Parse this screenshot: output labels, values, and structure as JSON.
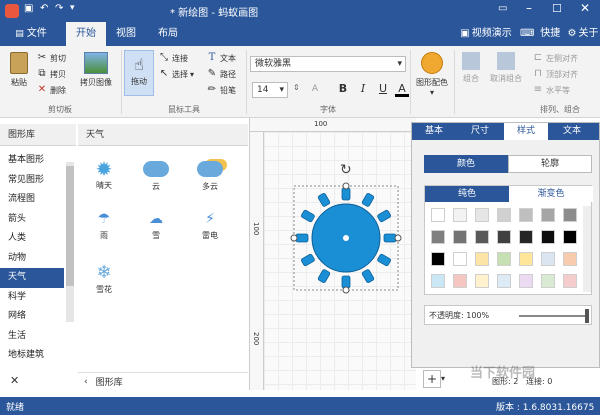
{
  "title": "* 新绘图 - 蚂蚁画图",
  "menu": {
    "file": "文件",
    "tabs": [
      "开始",
      "视图",
      "布局"
    ],
    "video": "视频演示",
    "shortcut": "快捷键",
    "about": "关于"
  },
  "ribbon": {
    "clipboard": {
      "paste": "粘贴",
      "cut": "剪切",
      "copy": "拷贝",
      "delete": "删除",
      "copy_image": "拷贝图像",
      "label": "剪切板"
    },
    "tools": {
      "drag": "拖动",
      "connect": "连接",
      "select": "选择",
      "text": "文本",
      "path": "路径",
      "pencil": "铅笔",
      "label": "鼠标工具"
    },
    "font": {
      "family": "微软雅黑",
      "size": "14",
      "bold": "B",
      "italic": "I",
      "underline": "U",
      "color": "A",
      "label": "字体"
    },
    "shape_color": "图形配色",
    "arrange": {
      "combine": "组合",
      "uncombine": "取消组合",
      "align_left": "左侧对齐",
      "align_top": "顶部对齐",
      "align_h": "水平等",
      "label": "排列、组合"
    }
  },
  "library": {
    "header": "图形库",
    "categories": [
      "基本图形",
      "常见图形",
      "流程图",
      "箭头",
      "人类",
      "动物",
      "天气",
      "科学",
      "网络",
      "生活",
      "地标建筑"
    ],
    "active_index": 6,
    "panel_title": "天气",
    "shapes": [
      "晴天",
      "云",
      "多云",
      "雨",
      "雪",
      "雷电",
      "雪花"
    ],
    "footer": "图形库"
  },
  "canvas": {
    "ruler_labels": [
      "100",
      "200"
    ],
    "vruler_labels": [
      "100",
      "200"
    ]
  },
  "right_panel": {
    "tabs": [
      "基本",
      "尺寸",
      "样式",
      "文本"
    ],
    "active_tab": 2,
    "sub_tabs": [
      "颜色",
      "轮廓"
    ],
    "color_tabs": [
      "纯色",
      "渐变色"
    ],
    "opacity_label": "不透明度: 100%",
    "opacity_value": 100
  },
  "colors": {
    "accent": "#2b579a",
    "sun_fill": "#1a8fd6",
    "grays": [
      "#ffffff",
      "#f2f2f2",
      "#e6e6e6",
      "#d1d1d1",
      "#bfbfbf",
      "#a6a6a6",
      "#8c8c8c",
      "#7f7f7f",
      "#737373",
      "#595959",
      "#404040",
      "#262626",
      "#0d0d0d"
    ],
    "palette_row3": [
      "#000000",
      "#ffffff",
      "#fce4a6",
      "#c6e0b4",
      "#ffe699",
      "#dbe5f1",
      "#f8cbad"
    ],
    "palette_row4": [
      "#c9e7f5",
      "#f6c7c2",
      "#fff2cc",
      "#ddebf7",
      "#ecd9f2",
      "#d9ead3",
      "#f4cccc"
    ]
  },
  "status": {
    "left": "就绪",
    "shapes": "图形: 2",
    "connections": "连接: 0",
    "version": "版本 : 1.6.8031.16675"
  },
  "watermark": "当下软件园"
}
